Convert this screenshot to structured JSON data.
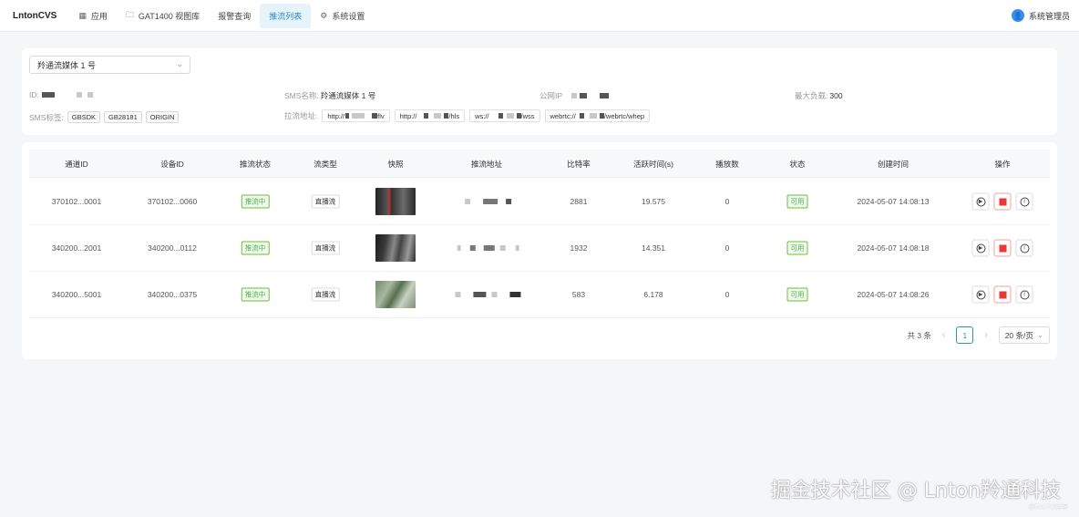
{
  "header": {
    "brand": "LntonCVS",
    "nav": [
      {
        "label": "应用",
        "icon": "grid-icon"
      },
      {
        "label": "GAT1400 视图库",
        "icon": "folder-icon"
      },
      {
        "label": "报警查询",
        "icon": ""
      },
      {
        "label": "推流列表",
        "icon": "",
        "active": true
      },
      {
        "label": "系统设置",
        "icon": "gear-icon"
      }
    ],
    "user": {
      "avatar": "user-avatar-icon",
      "name": "系统管理员"
    }
  },
  "info": {
    "select_value": "羚通流媒体 1 号",
    "id_label": "ID:",
    "sms_name_label": "SMS名称:",
    "sms_name_value": "羚通流媒体 1 号",
    "public_ip_label": "公网IP",
    "max_load_label": "最大负载:",
    "max_load_value": "300",
    "sms_tags_label": "SMS标签:",
    "sms_tags": [
      "GBSDK",
      "GB28181",
      "ORIGIN"
    ],
    "pull_addr_label": "拉流地址:",
    "pull_urls": [
      {
        "prefix": "http://",
        "suffix": "flv"
      },
      {
        "prefix": "http://",
        "suffix": "/hls"
      },
      {
        "prefix": "ws://",
        "suffix": "/wss"
      },
      {
        "prefix": "webrtc://",
        "suffix": "/webrtc/whep"
      }
    ]
  },
  "table": {
    "columns": [
      "通道ID",
      "设备ID",
      "推流状态",
      "流类型",
      "快照",
      "推流地址",
      "比特率",
      "活跃时间(s)",
      "播放数",
      "状态",
      "创建时间",
      "操作"
    ],
    "rows": [
      {
        "channel_id": "370102...0001",
        "device_id": "370102...0060",
        "push_status": "推流中",
        "stream_type": "直播流",
        "bitrate": "2881",
        "active_time": "19.575",
        "plays": "0",
        "state": "可用",
        "created": "2024-05-07 14:08:13"
      },
      {
        "channel_id": "340200...2001",
        "device_id": "340200...0112",
        "push_status": "推流中",
        "stream_type": "直播流",
        "bitrate": "1932",
        "active_time": "14.351",
        "plays": "0",
        "state": "可用",
        "created": "2024-05-07 14:08:18"
      },
      {
        "channel_id": "340200...5001",
        "device_id": "340200...0375",
        "push_status": "推流中",
        "stream_type": "直播流",
        "bitrate": "583",
        "active_time": "6.178",
        "plays": "0",
        "state": "可用",
        "created": "2024-05-07 14:08:26"
      }
    ]
  },
  "pagination": {
    "total": "共 3 条",
    "current_page": "1",
    "page_size": "20 条/页"
  },
  "watermark": {
    "main": "掘金技术社区 @ Lnton羚通科技",
    "sub": "@51CTO博客"
  },
  "colors": {
    "accent": "#2a8bd4",
    "green": "#4caf50",
    "stop_red": "#e53935",
    "page_active": "#2a9d8f"
  }
}
